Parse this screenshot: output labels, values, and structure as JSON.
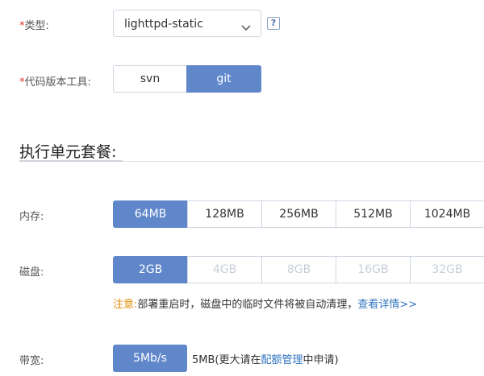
{
  "type_field": {
    "required_mark": "*",
    "label": "类型:",
    "selected": "lighttpd-static",
    "help_text": "?"
  },
  "vcs_field": {
    "required_mark": "*",
    "label": "代码版本工具:",
    "options": [
      "svn",
      "git"
    ],
    "selected": "git"
  },
  "section": {
    "title": "执行单元套餐:"
  },
  "memory": {
    "label": "内存:",
    "options": [
      "64MB",
      "128MB",
      "256MB",
      "512MB",
      "1024MB"
    ],
    "selected": "64MB"
  },
  "disk": {
    "label": "磁盘:",
    "options": [
      "2GB",
      "4GB",
      "8GB",
      "16GB",
      "32GB"
    ],
    "selected": "2GB",
    "disabled": [
      "4GB",
      "8GB",
      "16GB",
      "32GB"
    ]
  },
  "disk_note": {
    "prefix": "注意:",
    "text": "部署重启时，磁盘中的临时文件将被自动清理，",
    "link": "查看详情>>"
  },
  "bandwidth": {
    "label": "带宽:",
    "value": "5Mb/s",
    "info_before": "5MB(更大请在",
    "info_link": "配额管理",
    "info_after": "中申请)"
  },
  "colors": {
    "accent": "#5f87c9",
    "required": "#e0302a",
    "warning": "#e08b00",
    "link": "#2f74c0"
  }
}
